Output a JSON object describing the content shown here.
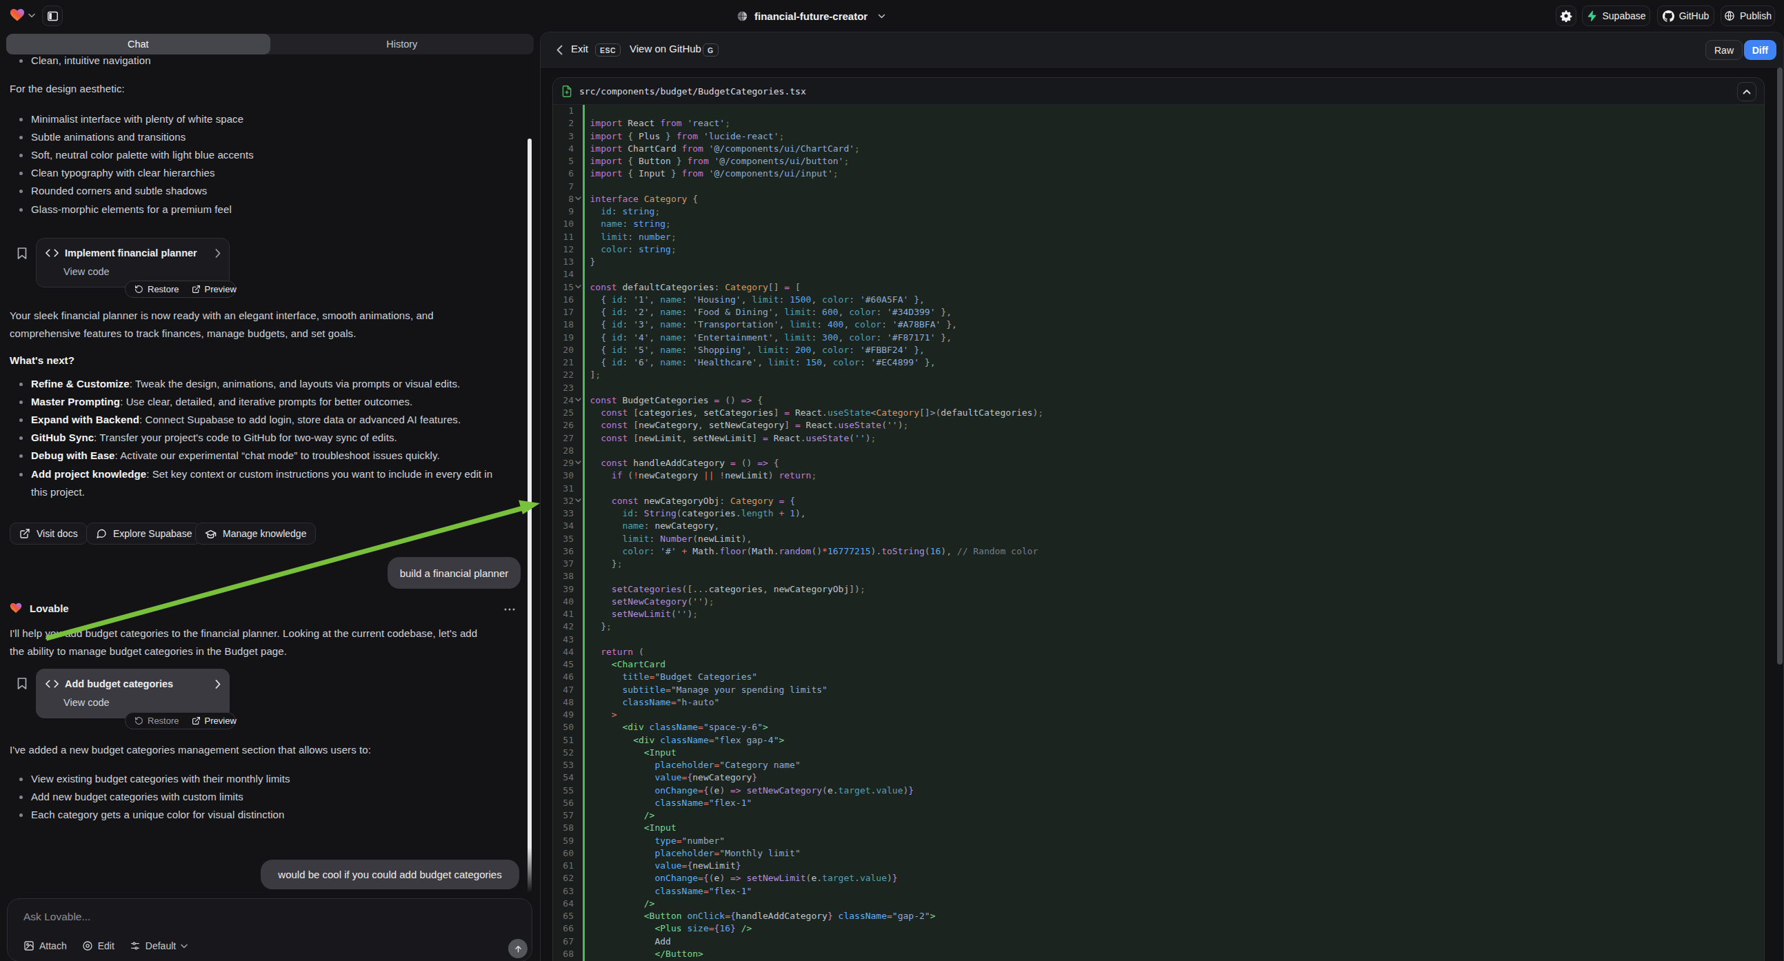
{
  "header": {
    "project_name": "financial-future-creator",
    "supabase_label": "Supabase",
    "github_label": "GitHub",
    "publish_label": "Publish"
  },
  "tabs": {
    "chat": "Chat",
    "history": "History"
  },
  "chat": {
    "scrollback_bullet": "Clean, intuitive navigation",
    "design_intro": "For the design aesthetic:",
    "design_bullets": [
      "Minimalist interface with plenty of white space",
      "Subtle animations and transitions",
      "Soft, neutral color palette with light blue accents",
      "Clean typography with clear hierarchies",
      "Rounded corners and subtle shadows",
      "Glass-morphic elements for a premium feel"
    ],
    "version_card_1": {
      "title": "Implement financial planner",
      "view_code": "View code",
      "restore": "Restore",
      "preview": "Preview"
    },
    "ready_paragraph": "Your sleek financial planner is now ready with an elegant interface, smooth animations, and comprehensive features to track finances, manage budgets, and set goals.",
    "whats_next_heading": "What's next?",
    "next_items": [
      {
        "label": "Refine & Customize",
        "text": ": Tweak the design, animations, and layouts via prompts or visual edits."
      },
      {
        "label": "Master Prompting",
        "text": ": Use clear, detailed, and iterative prompts for better outcomes."
      },
      {
        "label": "Expand with Backend",
        "text": ": Connect Supabase to add login, store data or advanced AI features."
      },
      {
        "label": "GitHub Sync",
        "text": ": Transfer your project's code to GitHub for two-way sync of edits."
      },
      {
        "label": "Debug with Ease",
        "text": ": Activate our experimental “chat mode” to troubleshoot issues quickly."
      },
      {
        "label": "Add project knowledge",
        "text": ": Set key context or custom instructions you want to include in every edit in this project."
      }
    ],
    "action_buttons": {
      "visit_docs": "Visit docs",
      "explore_supabase": "Explore Supabase",
      "manage_knowledge": "Manage knowledge"
    },
    "user_message_1": "build a financial planner",
    "assistant_name": "Lovable",
    "reply_intro": "I'll help you add budget categories to the financial planner. Looking at the current codebase, let's add the ability to manage budget categories in the Budget page.",
    "version_card_2": {
      "title": "Add budget categories",
      "view_code": "View code",
      "restore": "Restore",
      "preview": "Preview"
    },
    "added_paragraph": "I've added a new budget categories management section that allows users to:",
    "added_bullets": [
      "View existing budget categories with their monthly limits",
      "Add new budget categories with custom limits",
      "Each category gets a unique color for visual distinction"
    ],
    "user_message_2": "would be cool if you could add budget categories",
    "composer": {
      "placeholder": "Ask Lovable...",
      "attach": "Attach",
      "edit": "Edit",
      "mode": "Default"
    }
  },
  "code_panel": {
    "exit_label": "Exit",
    "esc_badge": "ESC",
    "view_on_github": "View on GitHub",
    "g_badge": "G",
    "raw_label": "Raw",
    "diff_label": "Diff",
    "file_path": "src/components/budget/BudgetCategories.tsx",
    "fold_lines": [
      8,
      15,
      24,
      29,
      32
    ],
    "code_lines": [
      "",
      "import React from 'react';",
      "import { Plus } from 'lucide-react';",
      "import ChartCard from '@/components/ui/ChartCard';",
      "import { Button } from '@/components/ui/button';",
      "import { Input } from '@/components/ui/input';",
      "",
      "interface Category {",
      "  id: string;",
      "  name: string;",
      "  limit: number;",
      "  color: string;",
      "}",
      "",
      "const defaultCategories: Category[] = [",
      "  { id: '1', name: 'Housing', limit: 1500, color: '#60A5FA' },",
      "  { id: '2', name: 'Food & Dining', limit: 600, color: '#34D399' },",
      "  { id: '3', name: 'Transportation', limit: 400, color: '#A78BFA' },",
      "  { id: '4', name: 'Entertainment', limit: 300, color: '#F87171' },",
      "  { id: '5', name: 'Shopping', limit: 200, color: '#FBBF24' },",
      "  { id: '6', name: 'Healthcare', limit: 150, color: '#EC4899' },",
      "];",
      "",
      "const BudgetCategories = () => {",
      "  const [categories, setCategories] = React.useState<Category[]>(defaultCategories);",
      "  const [newCategory, setNewCategory] = React.useState('');",
      "  const [newLimit, setNewLimit] = React.useState('');",
      "",
      "  const handleAddCategory = () => {",
      "    if (!newCategory || !newLimit) return;",
      "",
      "    const newCategoryObj: Category = {",
      "      id: String(categories.length + 1),",
      "      name: newCategory,",
      "      limit: Number(newLimit),",
      "      color: '#' + Math.floor(Math.random()*16777215).toString(16), // Random color",
      "    };",
      "",
      "    setCategories([...categories, newCategoryObj]);",
      "    setNewCategory('');",
      "    setNewLimit('');",
      "  };",
      "",
      "  return (",
      "    <ChartCard",
      "      title=\"Budget Categories\"",
      "      subtitle=\"Manage your spending limits\"",
      "      className=\"h-auto\"",
      "    >",
      "      <div className=\"space-y-6\">",
      "        <div className=\"flex gap-4\">",
      "          <Input",
      "            placeholder=\"Category name\"",
      "            value={newCategory}",
      "            onChange={(e) => setNewCategory(e.target.value)}",
      "            className=\"flex-1\"",
      "          />",
      "          <Input",
      "            type=\"number\"",
      "            placeholder=\"Monthly limit\"",
      "            value={newLimit}",
      "            onChange={(e) => setNewLimit(e.target.value)}",
      "            className=\"flex-1\"",
      "          />",
      "          <Button onClick={handleAddCategory} className=\"gap-2\">",
      "            <Plus size={16} />",
      "            Add",
      "            </Button>"
    ]
  },
  "annotation": {
    "arrow_color": "#79c13c"
  }
}
